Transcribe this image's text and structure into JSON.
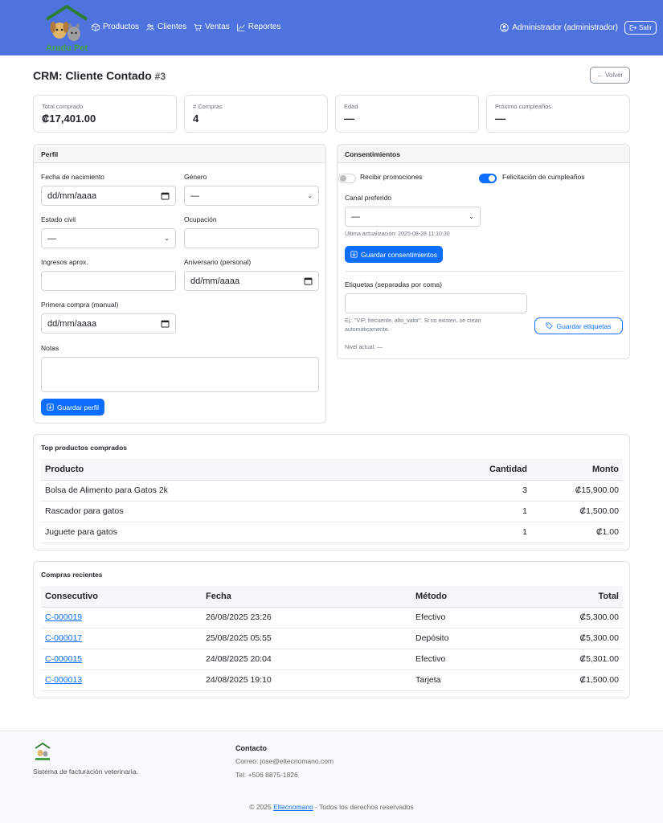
{
  "nav": {
    "brand": "Aradu Pet",
    "links": [
      "Productos",
      "Clientes",
      "Ventas",
      "Reportes"
    ],
    "user": "Administrador (administrador)",
    "exit": "Salir"
  },
  "page": {
    "title": "CRM: Cliente Contado",
    "id": "#3",
    "back": "← Volver"
  },
  "stats": [
    {
      "label": "Total comprado",
      "value": "₡17,401.00"
    },
    {
      "label": "# Compras",
      "value": "4"
    },
    {
      "label": "Edad",
      "value": "—"
    },
    {
      "label": "Próximo cumpleaños",
      "value": "—"
    }
  ],
  "perfil": {
    "header": "Perfil",
    "fecha_label": "Fecha de nacimiento",
    "fecha_value": "dd/mm/aaaa",
    "genero_label": "Género",
    "genero_value": "—",
    "estado_label": "Estado civil",
    "estado_value": "—",
    "ocupacion_label": "Ocupación",
    "ocupacion_value": "",
    "ingresos_label": "Ingresos aprox.",
    "ingresos_value": "",
    "aniversario_label": "Aniversario (personal)",
    "aniversario_value": "dd/mm/aaaa",
    "primera_label": "Primera compra (manual)",
    "primera_value": "dd/mm/aaaa",
    "notas_label": "Notas",
    "notas_value": "",
    "save": "Guardar perfil"
  },
  "consent": {
    "header": "Consentimientos",
    "promo": "Recibir promociones",
    "promo_on": false,
    "bday": "Felicitación de cumpleaños",
    "bday_on": true,
    "canal_label": "Canal preferido",
    "canal_value": "—",
    "updated": "Última actualización: 2025-08-28 11:10:30",
    "save": "Guardar consentimientos",
    "tags_label": "Etiquetas (separadas por coma)",
    "tags_value": "",
    "tags_help": "Ej.: \"VIP, frecuente, alto_valor\". Si no existen, se crean automáticamente.",
    "tags_save": "Guardar etiquetas",
    "nivel": "Nivel actual: —"
  },
  "top_products": {
    "title": "Top productos comprados",
    "headers": [
      "Producto",
      "Cantidad",
      "Monto"
    ],
    "rows": [
      [
        "Bolsa de Alimento para Gatos 2k",
        "3",
        "₡15,900.00"
      ],
      [
        "Rascador para gatos",
        "1",
        "₡1,500.00"
      ],
      [
        "Juguete para gatos",
        "1",
        "₡1.00"
      ]
    ]
  },
  "recent": {
    "title": "Compras recientes",
    "headers": [
      "Consecutivo",
      "Fecha",
      "Método",
      "Total"
    ],
    "rows": [
      [
        "C-000019",
        "26/08/2025 23:26",
        "Efectivo",
        "₡5,300.00"
      ],
      [
        "C-000017",
        "25/08/2025 05:55",
        "Depósito",
        "₡5,300.00"
      ],
      [
        "C-000015",
        "24/08/2025 20:04",
        "Efectivo",
        "₡5,301.00"
      ],
      [
        "C-000013",
        "24/08/2025 19:10",
        "Tarjeta",
        "₡1,500.00"
      ]
    ]
  },
  "footer": {
    "desc": "Sistema de facturación veterinaria.",
    "contact_title": "Contacto",
    "email": "Correo: jose@eltecnomano.com",
    "tel": "Tel: +506 8875-1826",
    "copy_pre": "© 2025 ",
    "copy_link": "Eltecnomano",
    "copy_post": " - Todos los derechos reservados"
  },
  "colors": {
    "navbar": "#4e73df",
    "primary": "#0d6efd",
    "logo_green": "#2e8b57",
    "logo_text": "#43a047"
  }
}
